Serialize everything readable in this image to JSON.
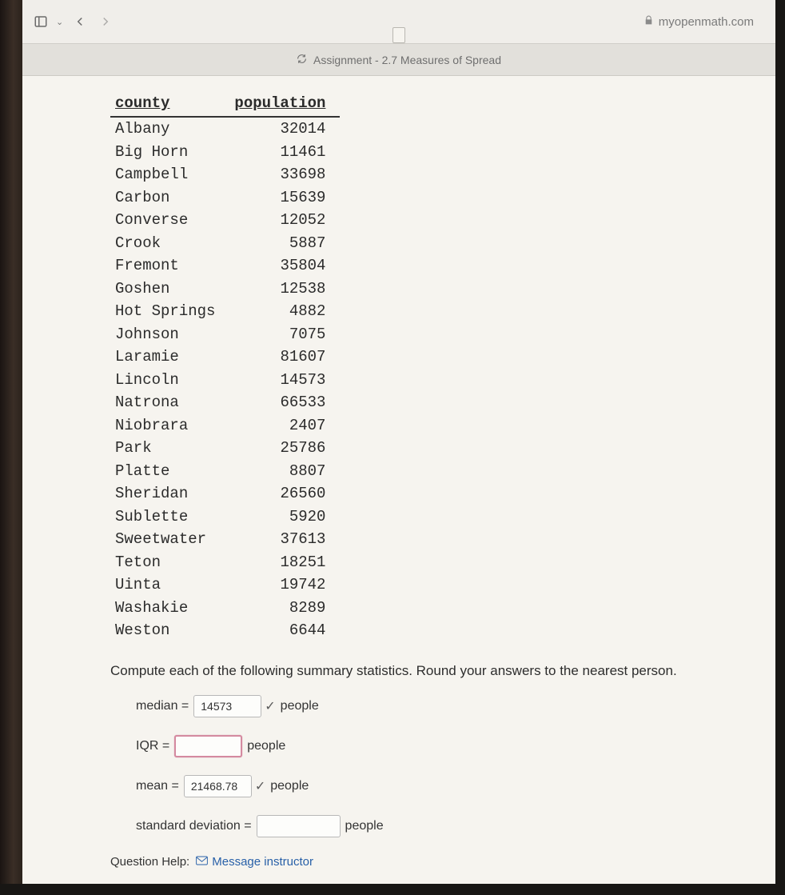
{
  "browser": {
    "domain": "myopenmath.com",
    "tab_title": "Assignment - 2.7 Measures of Spread"
  },
  "table": {
    "headers": {
      "county": "county",
      "population": "population"
    },
    "rows": [
      {
        "county": "Albany",
        "population": "32014"
      },
      {
        "county": "Big Horn",
        "population": "11461"
      },
      {
        "county": "Campbell",
        "population": "33698"
      },
      {
        "county": "Carbon",
        "population": "15639"
      },
      {
        "county": "Converse",
        "population": "12052"
      },
      {
        "county": "Crook",
        "population": "5887"
      },
      {
        "county": "Fremont",
        "population": "35804"
      },
      {
        "county": "Goshen",
        "population": "12538"
      },
      {
        "county": "Hot Springs",
        "population": "4882"
      },
      {
        "county": "Johnson",
        "population": "7075"
      },
      {
        "county": "Laramie",
        "population": "81607"
      },
      {
        "county": "Lincoln",
        "population": "14573"
      },
      {
        "county": "Natrona",
        "population": "66533"
      },
      {
        "county": "Niobrara",
        "population": "2407"
      },
      {
        "county": "Park",
        "population": "25786"
      },
      {
        "county": "Platte",
        "population": "8807"
      },
      {
        "county": "Sheridan",
        "population": "26560"
      },
      {
        "county": "Sublette",
        "population": "5920"
      },
      {
        "county": "Sweetwater",
        "population": "37613"
      },
      {
        "county": "Teton",
        "population": "18251"
      },
      {
        "county": "Uinta",
        "population": "19742"
      },
      {
        "county": "Washakie",
        "population": "8289"
      },
      {
        "county": "Weston",
        "population": "6644"
      }
    ]
  },
  "instructions": "Compute each of the following summary statistics. Round your answers to the nearest person.",
  "answers": {
    "median": {
      "label": "median =",
      "value": "14573",
      "unit": "people",
      "correct": true
    },
    "iqr": {
      "label": "IQR =",
      "value": "",
      "unit": "people",
      "correct": false
    },
    "mean": {
      "label": "mean =",
      "value": "21468.78",
      "unit": "people",
      "correct": true
    },
    "stddev": {
      "label": "standard deviation =",
      "value": "",
      "unit": "people",
      "correct": false
    }
  },
  "help": {
    "label": "Question Help:",
    "link": "Message instructor"
  }
}
